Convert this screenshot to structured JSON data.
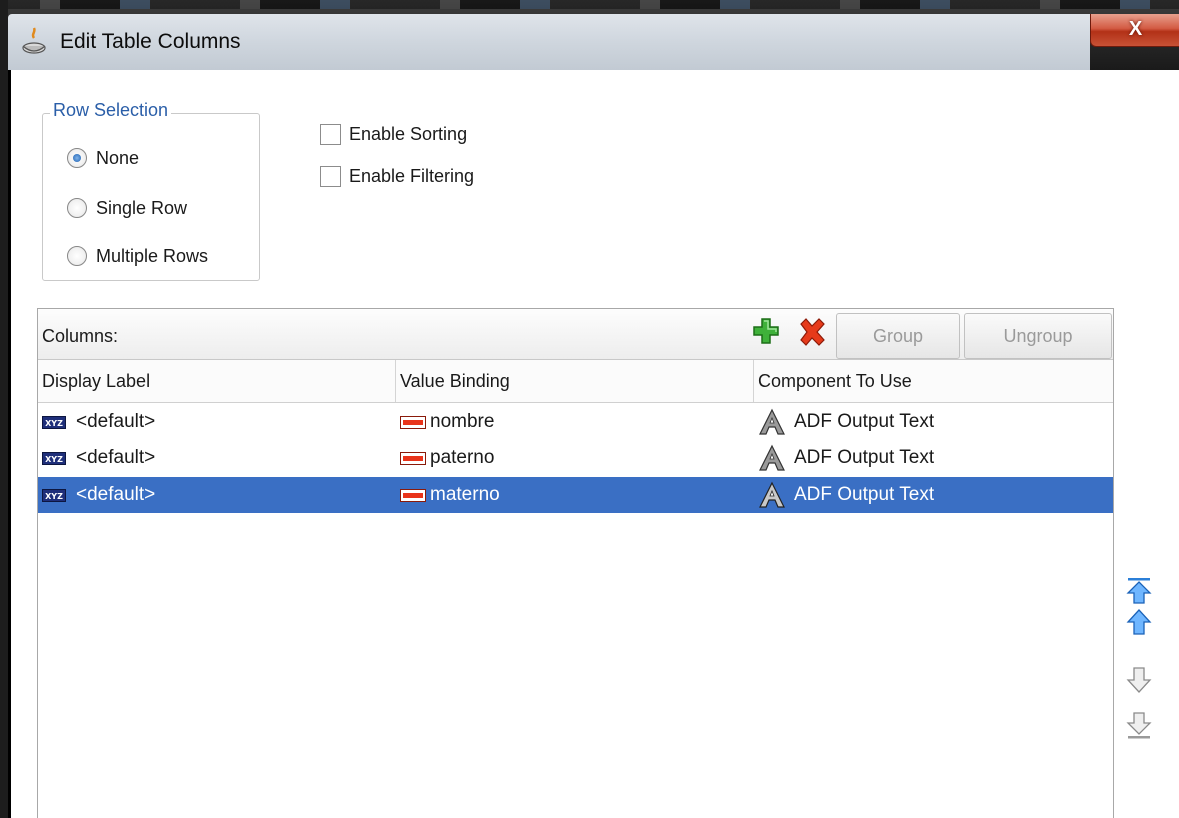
{
  "window": {
    "title": "Edit Table Columns",
    "close_label": "X"
  },
  "row_selection": {
    "legend": "Row Selection",
    "options": [
      {
        "label": "None",
        "checked": true
      },
      {
        "label": "Single Row",
        "checked": false
      },
      {
        "label": "Multiple Rows",
        "checked": false
      }
    ]
  },
  "options": {
    "enable_sorting": {
      "label": "Enable Sorting",
      "checked": false
    },
    "enable_filtering": {
      "label": "Enable Filtering",
      "checked": false
    }
  },
  "columns": {
    "label": "Columns:",
    "add_icon": "add-plus-icon",
    "delete_icon": "delete-x-icon",
    "group_label": "Group",
    "ungroup_label": "Ungroup",
    "headers": [
      "Display Label",
      "Value Binding",
      "Component To Use"
    ],
    "rows": [
      {
        "display": "<default>",
        "binding": "nombre",
        "component": "ADF Output Text",
        "selected": false
      },
      {
        "display": "<default>",
        "binding": "paterno",
        "component": "ADF Output Text",
        "selected": false
      },
      {
        "display": "<default>",
        "binding": "materno",
        "component": "ADF Output Text",
        "selected": true
      }
    ]
  },
  "reorder": [
    "move-top-icon",
    "move-up-icon",
    "move-down-icon",
    "move-bottom-icon"
  ]
}
